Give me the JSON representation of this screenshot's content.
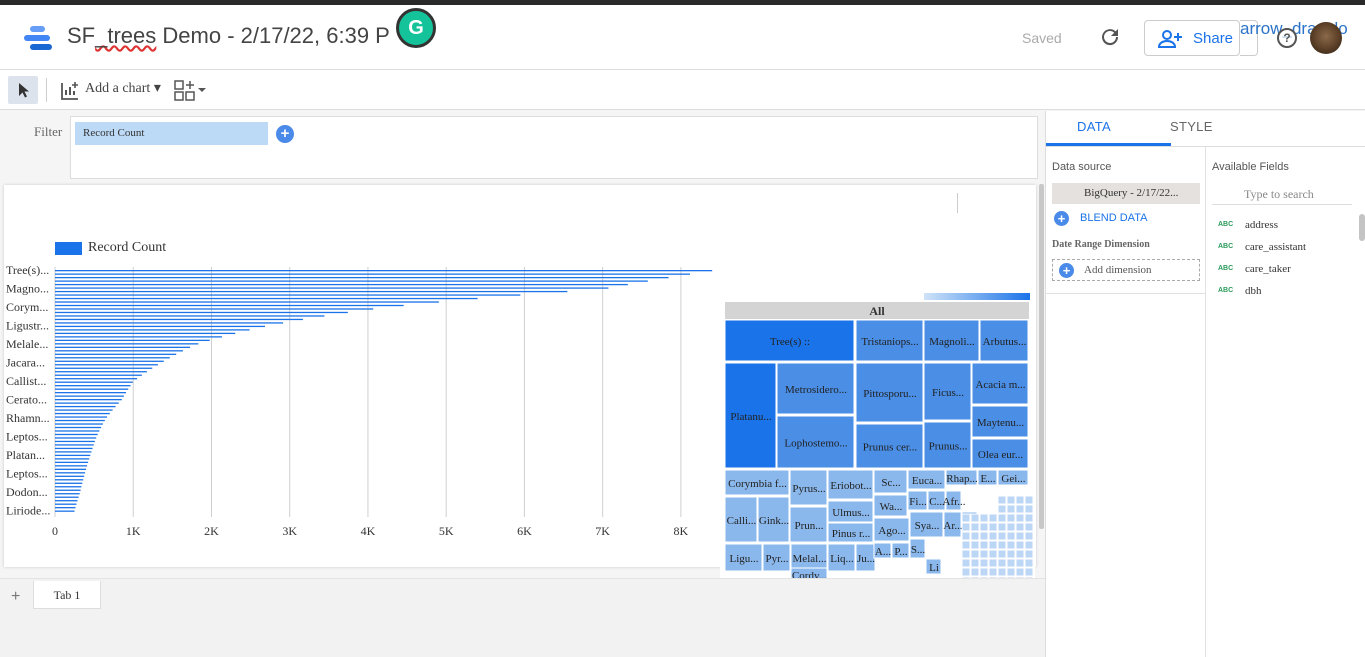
{
  "header": {
    "title_prefix": "SF",
    "title_underlined": "_trees",
    "title_rest": " Demo - 2/17/22, 6:39 P",
    "grammarly_letter": "G",
    "saved_label": "Saved",
    "share_label": "Share",
    "overlay_text": "arrow_drawdo",
    "help_glyph": "?"
  },
  "toolbar": {
    "add_chart_label": "Add a chart"
  },
  "filter": {
    "label": "Filter",
    "chip_label": "Record Count"
  },
  "chart_data": [
    {
      "type": "bar",
      "orientation": "horizontal",
      "legend": "Record Count",
      "categories": [
        "Tree(s)...",
        "Magno...",
        "Corym...",
        "Ligustr...",
        "Melale...",
        "Jacara...",
        "Callist...",
        "Cerato...",
        "Rhamn...",
        "Leptos...",
        "Platan...",
        "Leptos...",
        "Dodon...",
        "Liriode..."
      ],
      "values": [
        8400,
        7000,
        4200,
        2700,
        1800,
        1350,
        1000,
        850,
        650,
        530,
        450,
        380,
        320,
        250
      ],
      "xticks": [
        "0",
        "1K",
        "2K",
        "3K",
        "4K",
        "5K",
        "6K",
        "7K",
        "8K"
      ],
      "xlim": [
        0,
        8500
      ],
      "bar_color": "#1a73e8"
    },
    {
      "type": "treemap",
      "root_label": "All",
      "labels": [
        "Tree(s) ::",
        "Tristaniops...",
        "Magnoli...",
        "Arbutus...",
        "Platanu...",
        "Metrosidero...",
        "Pittosporu...",
        "Ficus...",
        "Acacia m...",
        "Lophostemo...",
        "Prunus cer...",
        "Prunus...",
        "Maytenu...",
        "Olea eur...",
        "Corymbia f...",
        "Pyrus...",
        "Eriobot...",
        "Sc...",
        "Euca...",
        "Rhap...",
        "E...",
        "Gei...",
        "Calli...",
        "Gink...",
        "Prun...",
        "Ulmus...",
        "Wa...",
        "Fi...",
        "C...",
        "Afr...",
        "Ligu...",
        "Pyr...",
        "Melal...",
        "Liq...",
        "Ju...",
        "Pinus r...",
        "Ago...",
        "Sya...",
        "Ar...",
        "Q...",
        "Cordy...",
        "A...",
        "P...",
        "S...",
        "Li"
      ],
      "colors": {
        "dark": "#1a73e8",
        "mid": "#4a8ee6",
        "light": "#8bb8ec",
        "lightest": "#bcd6f5"
      }
    }
  ],
  "tabs": {
    "add_glyph": "+",
    "tab1_label": "Tab 1"
  },
  "panel": {
    "tab_data": "DATA",
    "tab_style": "STYLE",
    "data_source_title": "Data source",
    "data_source_name": "BigQuery - 2/17/22...",
    "blend_label": "BLEND DATA",
    "date_range_label": "Date Range Dimension",
    "add_dimension_label": "Add dimension",
    "available_fields_title": "Available Fields",
    "search_placeholder": "Type to search",
    "field_type": "ABC",
    "fields": [
      "address",
      "care_assistant",
      "care_taker",
      "dbh"
    ]
  }
}
